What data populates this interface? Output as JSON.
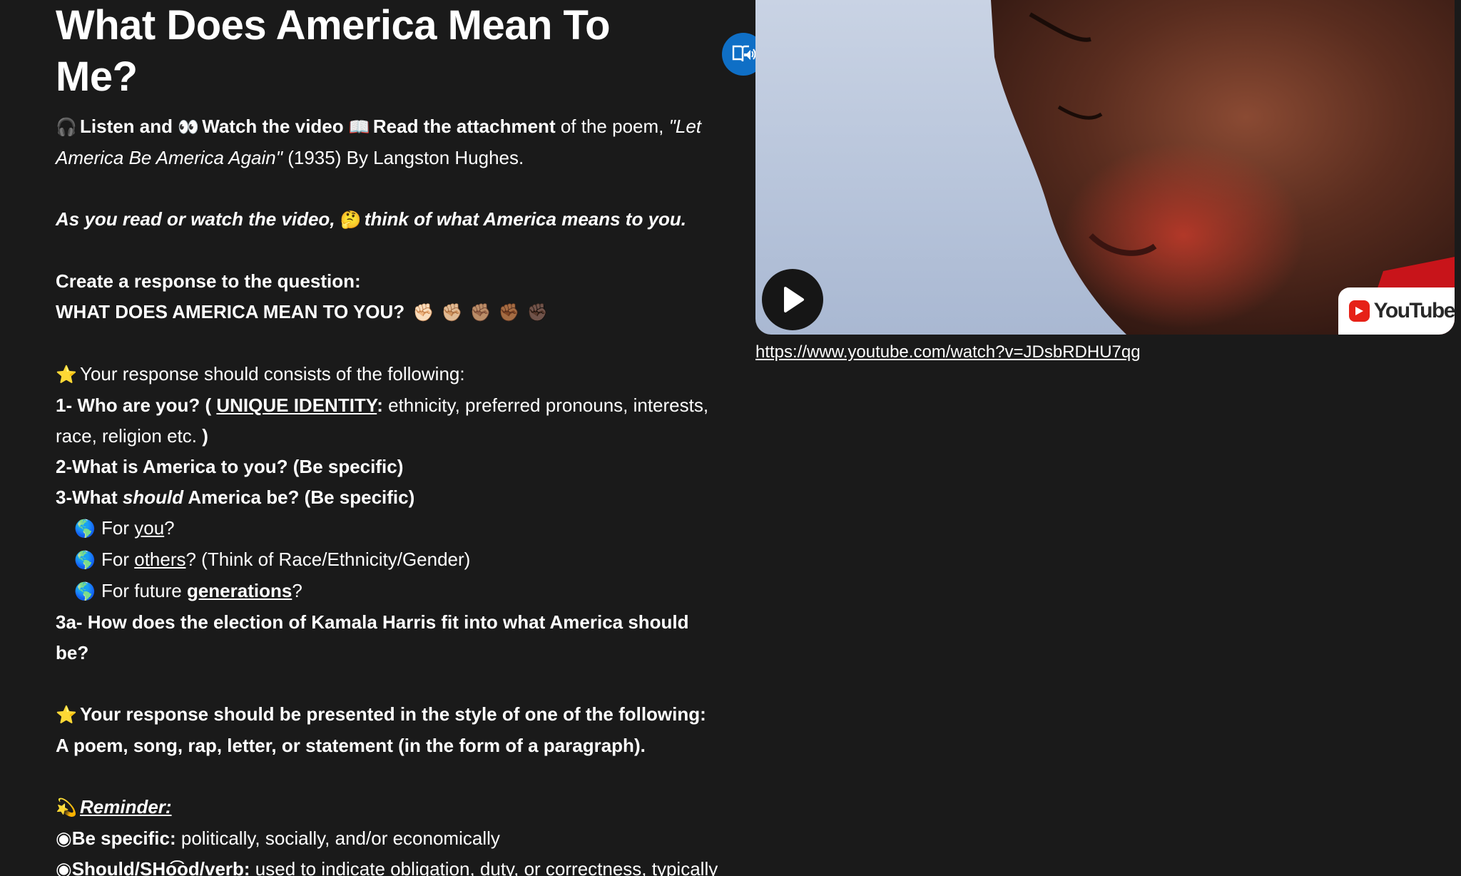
{
  "title": "What Does America Mean To Me?",
  "intro": {
    "listen": "Listen and",
    "watch": "Watch the video",
    "read": "Read the attachment",
    "of_poem": "of the poem,",
    "poem_title": "\"Let America Be America Again\"",
    "year_author": "(1935) By Langston Hughes."
  },
  "think": {
    "before": "As you read or watch the video,",
    "after": "think of what America means to you."
  },
  "create": {
    "line1": "Create a response to the question:",
    "line2": "WHAT DOES AMERICA MEAN TO YOU?"
  },
  "response": {
    "intro": "Your response should consists of the following:",
    "q1_prefix": "1- Who are you? (",
    "q1_link": "UNIQUE IDENTITY",
    "q1_colon": ":",
    "q1_rest": " ethnicity, preferred pronouns, interests, race, religion etc.",
    "q1_close": " )",
    "q2": "2-What is America to you? (Be specific)",
    "q3_prefix": "3-What ",
    "q3_italic": "should",
    "q3_rest": " America be? (Be specific)",
    "bullets": [
      {
        "pre": "For ",
        "link": "you",
        "post": "?"
      },
      {
        "pre": "For ",
        "link": "others",
        "post": "? (Think of Race/Ethnicity/Gender)"
      },
      {
        "pre": "For future ",
        "link": "generations",
        "post": "?"
      }
    ],
    "q3a": "3a- How does the election of Kamala Harris fit into what America should be?"
  },
  "style_note": "Your response should be presented in the style of one of the following: A poem, song, rap, letter, or statement (in the form of a paragraph).",
  "reminder": {
    "label": "Reminder:",
    "item1_label": "Be specific:",
    "item1_text": " politically, socially, and/or economically",
    "item2_label": "Should/SHo͡od/verb:",
    "item2_text": " used to indicate obligation, duty, or correctness, typically when criticizing someone's actions."
  },
  "video": {
    "brand": "YouTube",
    "url": "https://www.youtube.com/watch?v=JDsbRDHU7qg"
  },
  "icons": {
    "tts": "immersive-reader-icon",
    "play": "play-icon",
    "youtube": "youtube-logo"
  },
  "colors": {
    "background": "#1a1a1a",
    "text": "#ffffff",
    "tts_button": "#0f6fc6",
    "youtube_red": "#e62117"
  }
}
